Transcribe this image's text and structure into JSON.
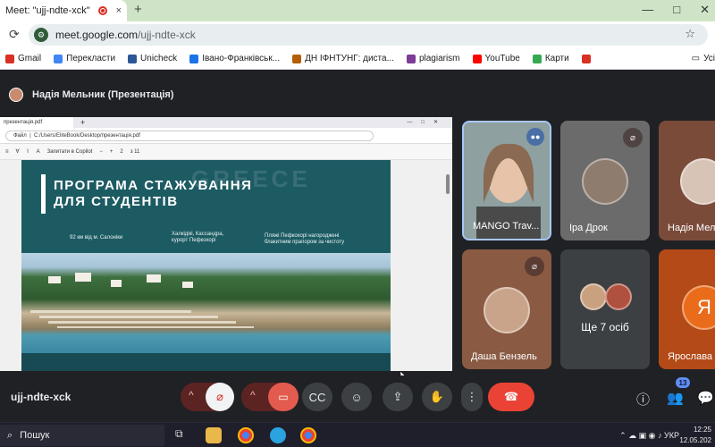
{
  "browser": {
    "tab_title": "Meet: \"ujj-ndte-xck\"",
    "tab_close": "×",
    "newtab": "+",
    "win_min": "—",
    "win_max": "□",
    "win_close": "✕",
    "url_host": "meet.google.com",
    "url_path": "/ujj-ndte-xck",
    "bookmarks": [
      {
        "label": "Gmail",
        "color": "#d93025"
      },
      {
        "label": "Перекласти",
        "color": "#4285f4"
      },
      {
        "label": "Unicheck",
        "color": "#2b5797"
      },
      {
        "label": "Івано-Франківськ...",
        "color": "#1a73e8"
      },
      {
        "label": "ДН ІФНТУНГ: диста...",
        "color": "#b45f06"
      },
      {
        "label": "plagiarism",
        "color": "#7d3c98"
      },
      {
        "label": "YouTube",
        "color": "#ff0000"
      },
      {
        "label": "Карти",
        "color": "#34a853"
      },
      {
        "label": "",
        "color": "#d93025"
      }
    ],
    "bookmarks_last": "Усі"
  },
  "meet": {
    "presenter_title": "Надія Мельник (Презентація)",
    "meeting_code": "ujj-ndte-xck",
    "people_count": "13",
    "participants": [
      {
        "name": "MANGO Trav...",
        "state": "speaking"
      },
      {
        "name": "Іра Дрок",
        "state": "muted"
      },
      {
        "name": "Надія Мел...",
        "state": ""
      },
      {
        "name": "Даша Бензель",
        "state": "muted"
      },
      {
        "name": "Ще 7 осіб",
        "state": ""
      },
      {
        "name": "Ярослава Б...",
        "state": ""
      }
    ],
    "avatar_letter": "Я"
  },
  "pdf": {
    "tab_label": "презентація.pdf",
    "path_label": "Файл",
    "path": "C:/Users/EliteBook/Desktop/презентація.pdf",
    "copilot": "Запитати в Copilot",
    "page_current": "2",
    "page_total": "з 11",
    "slide_title_1": "ПРОГРАМА СТАЖУВАННЯ",
    "slide_title_2": "ДЛЯ СТУДЕНТІВ",
    "watermark": "GREECE",
    "caption_1": "92 км від м. Салоніки",
    "caption_2a": "Халкідікі, Кассандра,",
    "caption_2b": "курорт Пефкохорі",
    "caption_3a": "Пляжі Пефкохорі нагороджені",
    "caption_3b": "блакитним прапором за чистоту"
  },
  "taskbar": {
    "search": "Пошук",
    "lang": "УКР",
    "time": "12:25",
    "date": "12.05.202"
  }
}
